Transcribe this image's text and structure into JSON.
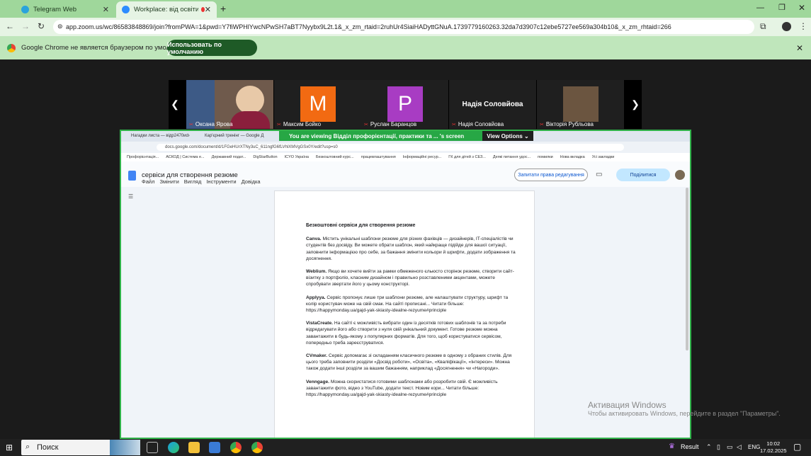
{
  "browser": {
    "tabs": [
      {
        "title": "Telegram Web"
      },
      {
        "title": "Workplace: від освіти до кар"
      }
    ],
    "new_tab_label": "+",
    "address": "app.zoom.us/wc/86583848869/join?fromPWA=1&pwd=Y7fiWPHlYwcNPwSH7aBT7Nyybx9L2t.1&_x_zm_rtaid=2ruhUr4SiaiHADyttGNuA.1739779160263.32da7d3907c12ebe5727ee569a304b10&_x_zm_rhtaid=266",
    "infobar_text": "Google Chrome не является браузером по умолчанию.",
    "default_button": "Использовать по умолчанию",
    "colors": {
      "frame": "#9fd79b",
      "toolbar": "#e6f4e4",
      "accent": "#1e5a26"
    }
  },
  "zoom": {
    "participants": [
      {
        "name": "Оксана Ярова",
        "initial": "",
        "color": "#7a5b4a"
      },
      {
        "name": "Максим Бойко",
        "initial": "M",
        "color": "#f26a12"
      },
      {
        "name": "Руслан Баранцов",
        "initial": "P",
        "color": "#a83cc3"
      },
      {
        "name": "Надія Соловйова",
        "initial": "",
        "color": "#1f1f1f",
        "big_name": "Надія Соловйова"
      },
      {
        "name": "Вікторія Рубльова",
        "initial": "",
        "color": "#6b5540"
      }
    ],
    "viewing_text": "You are viewing  Відділ профорієнтації, практики та ... 's screen",
    "view_options": "View Options"
  },
  "shared": {
    "tabs": [
      "Нагадки листа — відр2470иd›",
      "Кар'єрний тренінг — Google Д"
    ],
    "url": "docs.google.com/document/d/1FGeHUrXTNy3uC_611ngfG6fLVhlXMVgGSx0Y/edit?usp=s0",
    "bookmarks": [
      "Профорієнтація...",
      "АСКОД | Система е...",
      "Державний подат...",
      "DigStarButton",
      "ICYO Україна",
      "Безкоштовний курс...",
      "працевлаштування",
      "Інформаційні ресур...",
      "ГК для дітей з СЕЗ...",
      "Деякі питання удос...",
      "помилки",
      "Нова вкладка",
      "Усі закладки"
    ],
    "doc_title": "сервіси для створення резюме",
    "menu": [
      "Файл",
      "Змінити",
      "Вигляд",
      "Інструменти",
      "Довідка"
    ],
    "access_button": "Запитати права редагування",
    "share_button": "Поділитися",
    "content": {
      "heading": "Безкоштовні сервіси для створення резюме",
      "paragraphs": [
        {
          "bold": "Canva.",
          "text": " Містить унікальні шаблони резюме для різних фахівців — дизайнерів, IT-спеціалістів чи студентів без досвіду. Ви можете обрати шаблон, який найкраще підійде для вашої ситуації, заповнити інформацією про себе, за бажання змінити кольори й шрифти, додати зображення та досягнення."
        },
        {
          "bold": "Weblium.",
          "text": " Якщо ви хочете вийти за рамки обмеженого єльюсто сторінок резюме, створити сайт-візитку з портфоліо, класним дизайном і правильно розставленими акцентами, можете спробувати звертати його у цьому конструкторі."
        },
        {
          "bold": "Applyya.",
          "text": " Сервіс пропонує лише три шаблони резюме, але налаштувати структуру, шрифт та колір користувач може на свій смак. На сайті прописані... Читати більше: https://happymonday.ua/gajd-yak-skiasty-idealne-rezyume#principle"
        },
        {
          "bold": "VistaCreate.",
          "text": " На сайті є можливість вибрати один із десятків готових шаблонів та за потреби відредагувати його або створити з нуля свій унікальний документ. Готове резюме можна завантажити в будь-якому з популярних форматів. Для того, щоб користуватися сервісом, попередньо треба зареєструватися."
        },
        {
          "bold": "CVmaker.",
          "text": " Сервіс допомагає зі складанням класичного резюме в одному з обраних стилів. Для цього треба заповнити розділи «Досвід роботи», «Освіта», «Кваліфікації», «Інтереси». Можна також додати інші розділи за вашим бажанням, наприклад «Досягнення» чи «Нагороди»."
        },
        {
          "bold": "Venngage.",
          "text": " Можна скористатися готовими шаблонами або розробити свій. Є можливість завантажити фото, відео з YouTube, додати текст. Новим кори... Читати більше: https://happymonday.ua/gajd-yak-skiasty-idealne-rezyume#principle"
        }
      ]
    }
  },
  "windows": {
    "activation_title": "Активация Windows",
    "activation_sub": "Чтобы активировать Windows, перейдите в раздел \"Параметры\".",
    "search_label": "Поиск",
    "result_label": "Result",
    "lang": "ENG",
    "time": "10:02",
    "date": "17.02.2025"
  }
}
